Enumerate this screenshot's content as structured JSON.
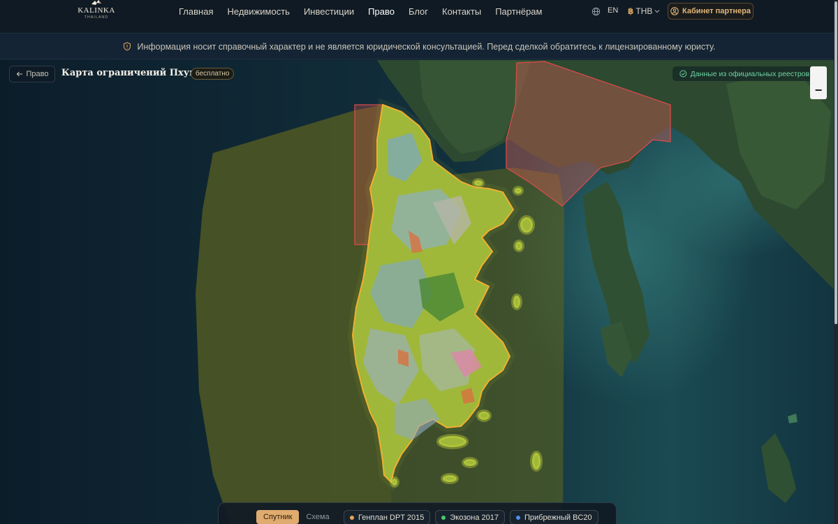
{
  "header": {
    "logo": {
      "brand": "KALINKA",
      "sub": "THAILAND"
    },
    "nav": [
      "Главная",
      "Недвижимость",
      "Инвестиции",
      "Право",
      "Блог",
      "Контакты",
      "Партнёрам"
    ],
    "active_nav": "Право",
    "language": "EN",
    "currency_symbol": "฿",
    "currency": "THB",
    "partner_button": "Кабинет партнера"
  },
  "notice": {
    "text": "Информация носит справочный характер и не является юридической консультацией. Перед сделкой обратитесь к лицензированному юристу."
  },
  "page": {
    "back_label": "Право",
    "title": "Карта ограничений Пхукета",
    "badge": "бесплатно",
    "source": "Данные из официальных реестров DPT"
  },
  "map": {
    "zoom_out": "−",
    "base_layers": [
      "Спутник",
      "Схема"
    ],
    "active_base": "Спутник",
    "layers": [
      {
        "label": "Генплан DPT 2015",
        "color": "#e8a45a"
      },
      {
        "label": "Экозона 2017",
        "color": "#49c96e"
      },
      {
        "label": "Прибрежный BC20",
        "color": "#4f8ff0"
      }
    ]
  },
  "colors": {
    "accent": "#e0ab6f",
    "sea": "#0f2330",
    "land": "#2c4a32",
    "zone_olive": "#5b6220",
    "zone_red": "#e04a4a",
    "island_yellow": "#c9d63a"
  }
}
